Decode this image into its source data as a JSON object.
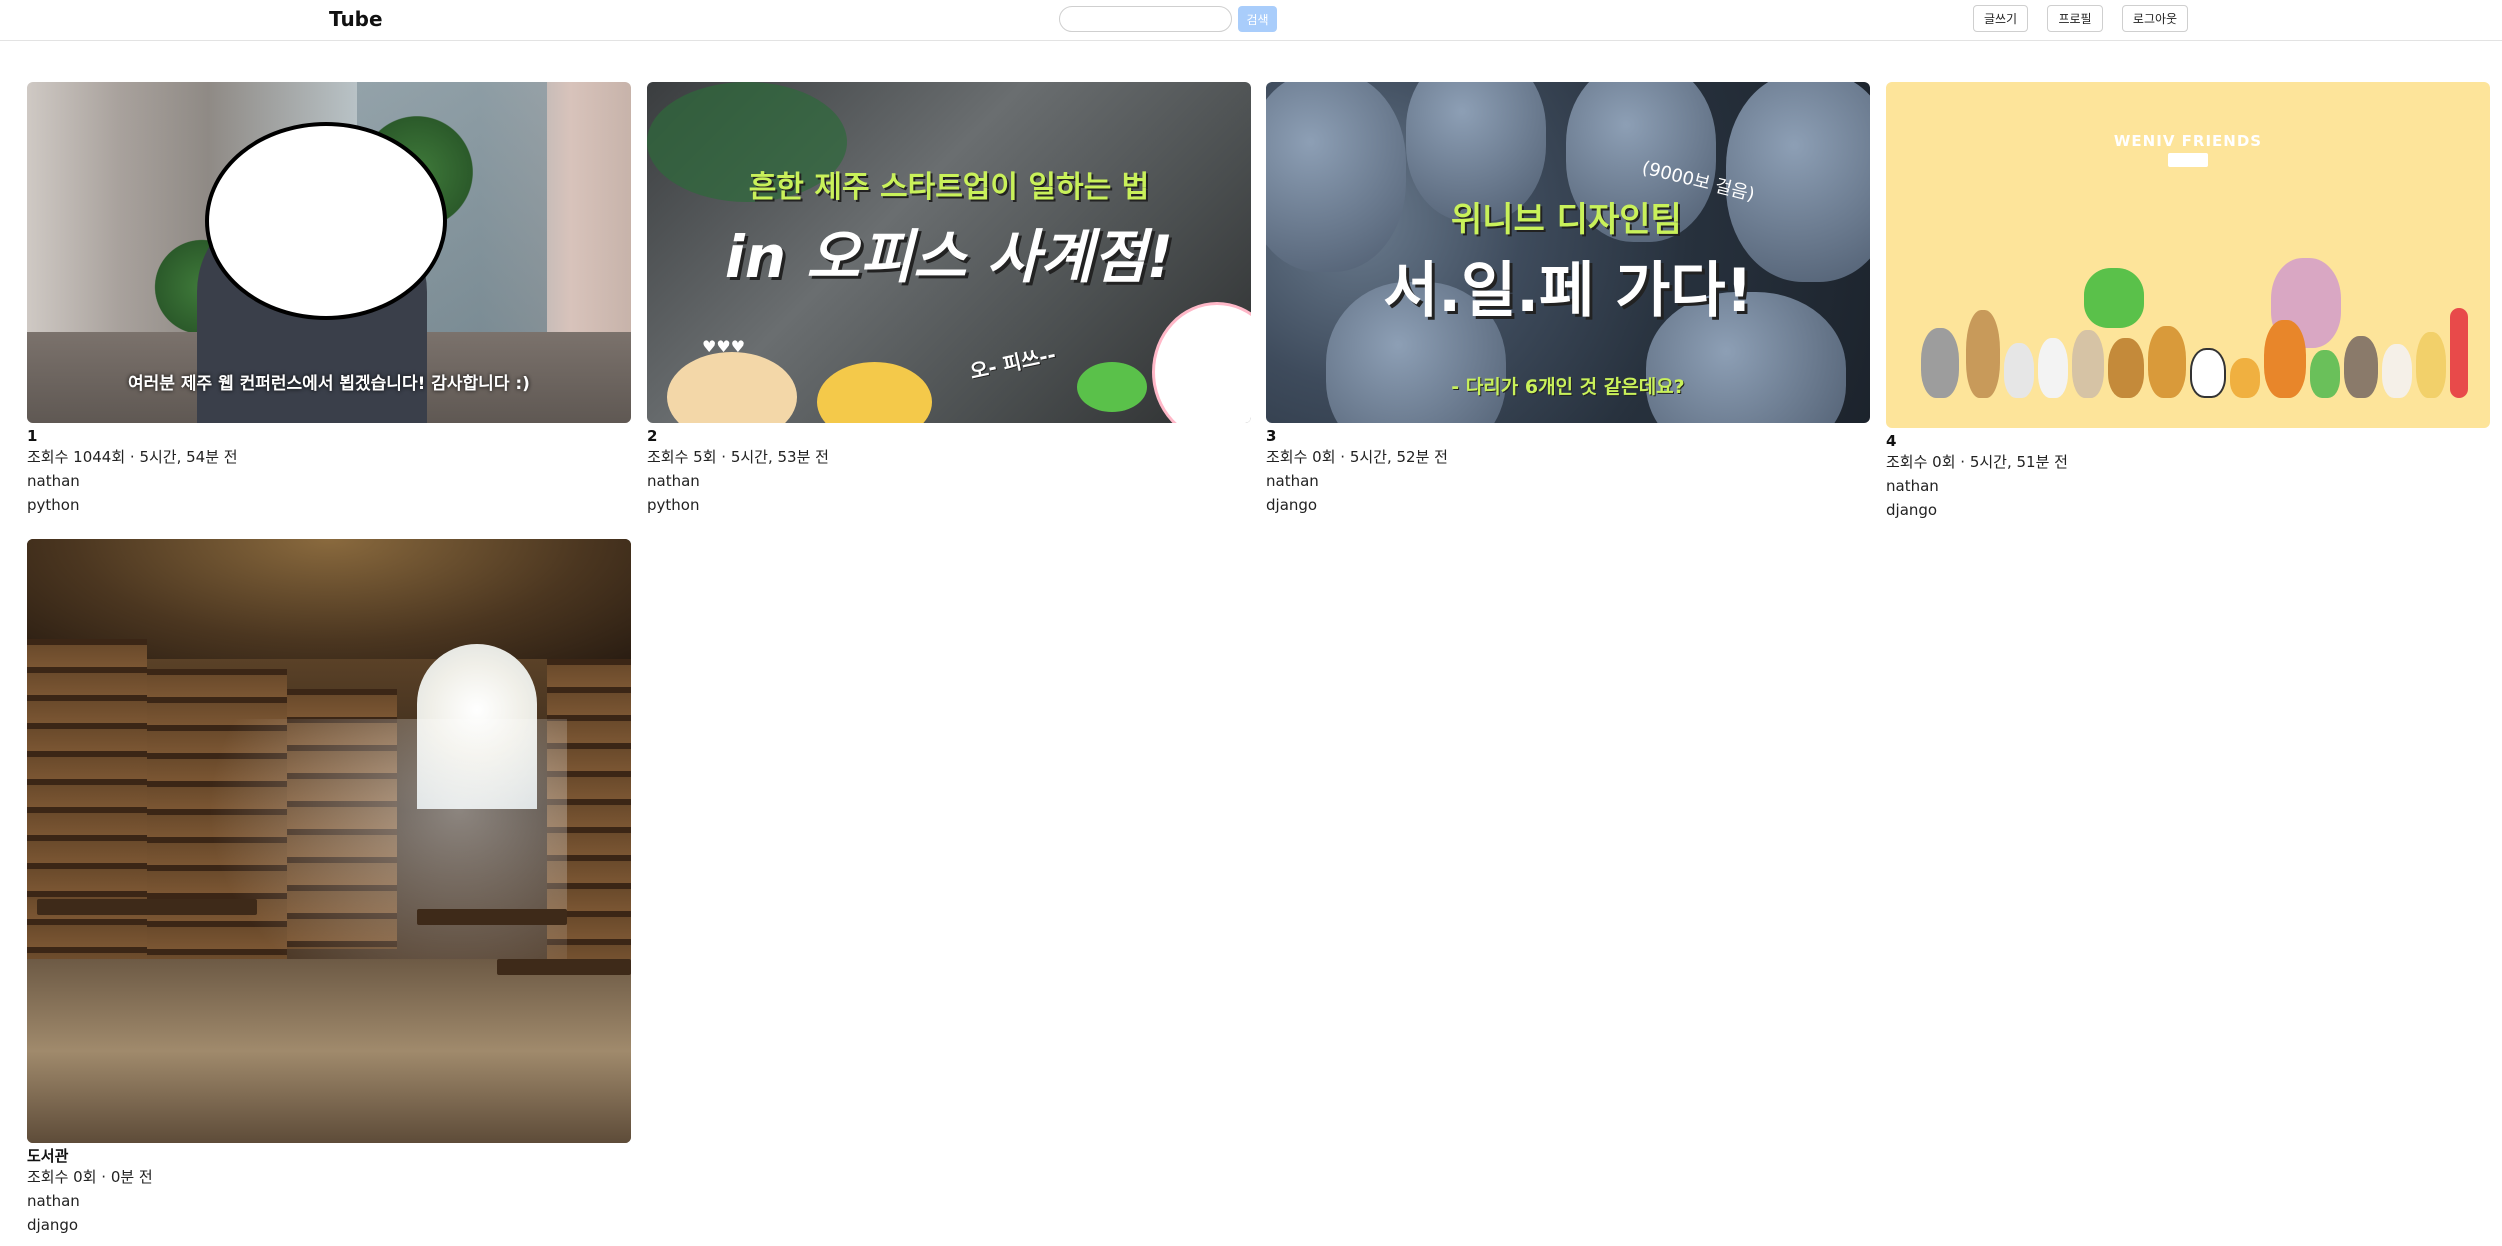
{
  "header": {
    "logo": "Tube",
    "search": {
      "placeholder": "",
      "value": "",
      "button_label": "검색"
    },
    "nav": {
      "write_label": "글쓰기",
      "profile_label": "프로필",
      "logout_label": "로그아웃"
    }
  },
  "colors": {
    "accent": "#a9cdfb",
    "text": "#222222",
    "border": "#cfcfcf"
  },
  "videos": [
    {
      "title": "1",
      "meta": "조회수 1044회 · 5시간, 54분 전",
      "author": "nathan",
      "category": "python",
      "thumbnail": {
        "caption": "여러분 제주 웹 컨퍼런스에서 뵙겠습니다! 감사합니다 :)"
      }
    },
    {
      "title": "2",
      "meta": "조회수 5회 · 5시간, 53분 전",
      "author": "nathan",
      "category": "python",
      "thumbnail": {
        "top": "흔한 제주 스타트업이 일하는 법",
        "main": "in 오피스 사계점!",
        "small": "오- 피쓰--",
        "hearts": "♥♥♥"
      }
    },
    {
      "title": "3",
      "meta": "조회수 0회 · 5시간, 52분 전",
      "author": "nathan",
      "category": "django",
      "thumbnail": {
        "team": "위니브 디자인팀",
        "main": "서.일.페 가다!",
        "steps": "(9000보 걸음)",
        "bottom": "- 다리가 6개인 것 같은데요?"
      }
    },
    {
      "title": "4",
      "meta": "조회수 0회 · 5시간, 51분 전",
      "author": "nathan",
      "category": "django",
      "thumbnail": {
        "brand": "WENIV FRIENDS"
      }
    },
    {
      "title": "도서관",
      "meta": "조회수 0회 · 0분 전",
      "author": "nathan",
      "category": "django",
      "thumbnail": {}
    }
  ]
}
